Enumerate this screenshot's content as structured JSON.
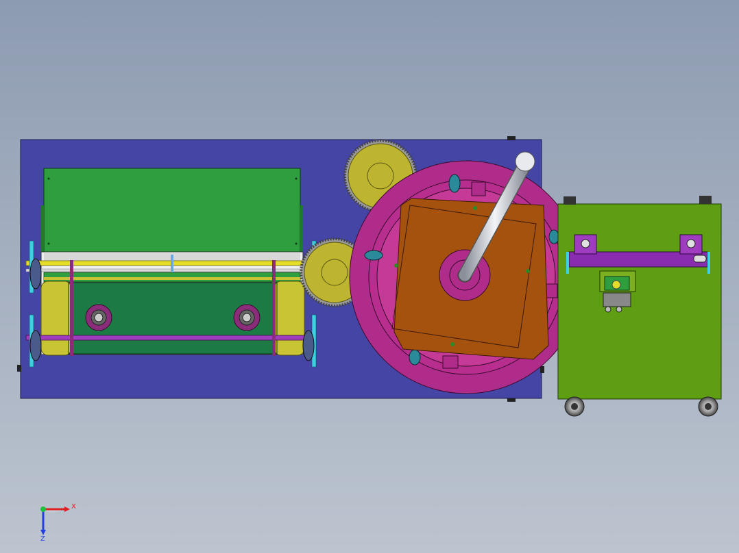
{
  "app": {
    "view": "cad-3d-viewport",
    "background_top": "#8d9bb1",
    "background_bottom": "#bcc4cf"
  },
  "triad": {
    "x_label": "X",
    "z_label": "Z",
    "x_color": "#e02020",
    "y_color": "#20c040",
    "z_color": "#2040e0"
  },
  "colors": {
    "base_plate": "#4545a5",
    "green_plate": "#2f9e3e",
    "dark_green": "#1c7a45",
    "roller_yellow": "#c9c434",
    "magenta": "#b02c8a",
    "orange_block": "#a4520e",
    "side_table": "#5f9e12",
    "purple_bar": "#8a2cb0",
    "gear_olive": "#bdb530"
  }
}
